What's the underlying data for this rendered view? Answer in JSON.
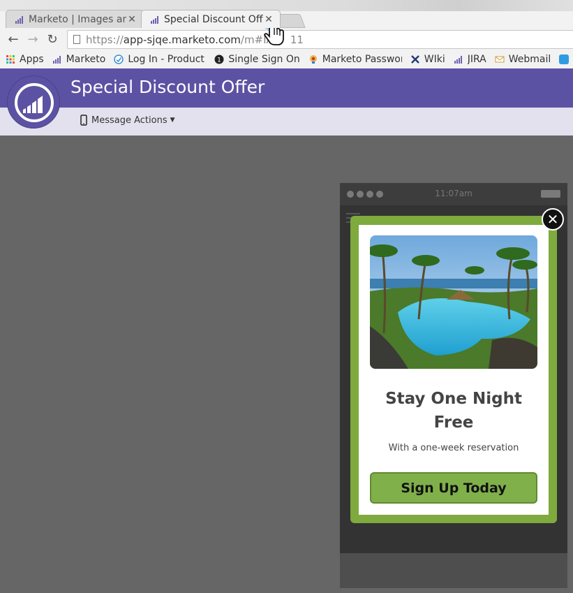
{
  "browser": {
    "tabs": [
      {
        "label": "Marketo | Images an",
        "close": "✕"
      },
      {
        "label": "Special Discount Off",
        "close": "✕"
      }
    ],
    "url_prefix": "https://",
    "url_host": "app-sjqe.marketo.com",
    "url_rest": "/m#IA",
    "url_tail": "11",
    "bookmarks": [
      {
        "label": "Apps",
        "icon": "apps-grid-icon"
      },
      {
        "label": "Marketo",
        "icon": "marketo-icon"
      },
      {
        "label": "Log In - Product D",
        "icon": "login-icon"
      },
      {
        "label": "Single Sign On",
        "icon": "one-icon"
      },
      {
        "label": "Marketo Passworc",
        "icon": "password-icon"
      },
      {
        "label": "WIki",
        "icon": "wiki-icon"
      },
      {
        "label": "JIRA",
        "icon": "marketo-icon"
      },
      {
        "label": "Webmail",
        "icon": "mail-icon"
      }
    ]
  },
  "app": {
    "title": "Special Discount Offer",
    "message_actions": "Message Actions",
    "accent": "#5c52a3"
  },
  "phone": {
    "time": "11:07am"
  },
  "modal": {
    "headline_line1": "Stay One Night",
    "headline_line2": "Free",
    "subtext": "With a one-week reservation",
    "cta": "Sign Up Today",
    "close": "✕",
    "frame_color": "#7faa3e"
  }
}
